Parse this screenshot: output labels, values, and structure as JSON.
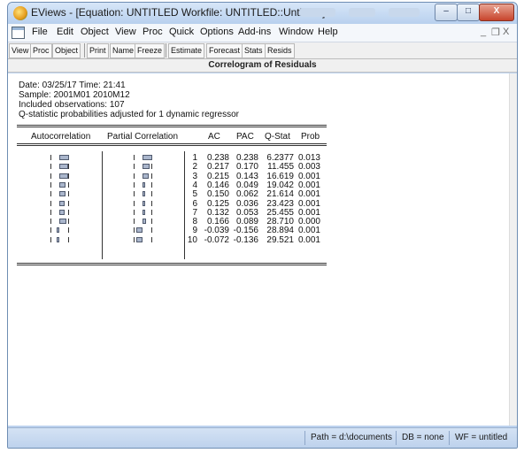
{
  "window": {
    "title": "EViews - [Equation: UNTITLED   Workfile: UNTITLED::Untitled\\]",
    "minimize_label": "–",
    "maximize_label": "□",
    "close_label": "X"
  },
  "menu": {
    "items": [
      "File",
      "Edit",
      "Object",
      "View",
      "Proc",
      "Quick",
      "Options",
      "Add-ins",
      "Window",
      "Help"
    ],
    "mdi_minimize": "_",
    "mdi_restore": "❐",
    "mdi_close": "X"
  },
  "toolbar": {
    "buttons": [
      "View",
      "Proc",
      "Object",
      "Print",
      "Name",
      "Freeze",
      "Estimate",
      "Forecast",
      "Stats",
      "Resids"
    ]
  },
  "view_title": "Correlogram of Residuals",
  "header": {
    "date_line": "Date: 03/25/17   Time: 21:41",
    "sample_line": "Sample: 2001M01 2010M12",
    "obs_line": "Included observations: 107",
    "qstat_note": "Q-statistic probabilities adjusted for 1 dynamic regressor"
  },
  "columns": {
    "autocorrelation": "Autocorrelation",
    "partial_correlation": "Partial Correlation",
    "ac": "AC",
    "pac": "PAC",
    "qstat": "Q-Stat",
    "prob": "Prob"
  },
  "rows": [
    {
      "lag": "1",
      "ac": "0.238",
      "pac": "0.238",
      "q": "6.2377",
      "prob": "0.013"
    },
    {
      "lag": "2",
      "ac": "0.217",
      "pac": "0.170",
      "q": "11.455",
      "prob": "0.003"
    },
    {
      "lag": "3",
      "ac": "0.215",
      "pac": "0.143",
      "q": "16.619",
      "prob": "0.001"
    },
    {
      "lag": "4",
      "ac": "0.146",
      "pac": "0.049",
      "q": "19.042",
      "prob": "0.001"
    },
    {
      "lag": "5",
      "ac": "0.150",
      "pac": "0.062",
      "q": "21.614",
      "prob": "0.001"
    },
    {
      "lag": "6",
      "ac": "0.125",
      "pac": "0.036",
      "q": "23.423",
      "prob": "0.001"
    },
    {
      "lag": "7",
      "ac": "0.132",
      "pac": "0.053",
      "q": "25.455",
      "prob": "0.001"
    },
    {
      "lag": "8",
      "ac": "0.166",
      "pac": "0.089",
      "q": "28.710",
      "prob": "0.000"
    },
    {
      "lag": "9",
      "ac": "-0.039",
      "pac": "-0.156",
      "q": "28.894",
      "prob": "0.001"
    },
    {
      "lag": "10",
      "ac": "-0.072",
      "pac": "-0.136",
      "q": "29.521",
      "prob": "0.001"
    }
  ],
  "status": {
    "path": "Path = d:\\documents",
    "db": "DB = none",
    "wf": "WF = untitled"
  },
  "colors": {
    "bar_fill": "#aab6cc",
    "titlebar": "#b8d0ee",
    "close_button": "#c7442c"
  }
}
